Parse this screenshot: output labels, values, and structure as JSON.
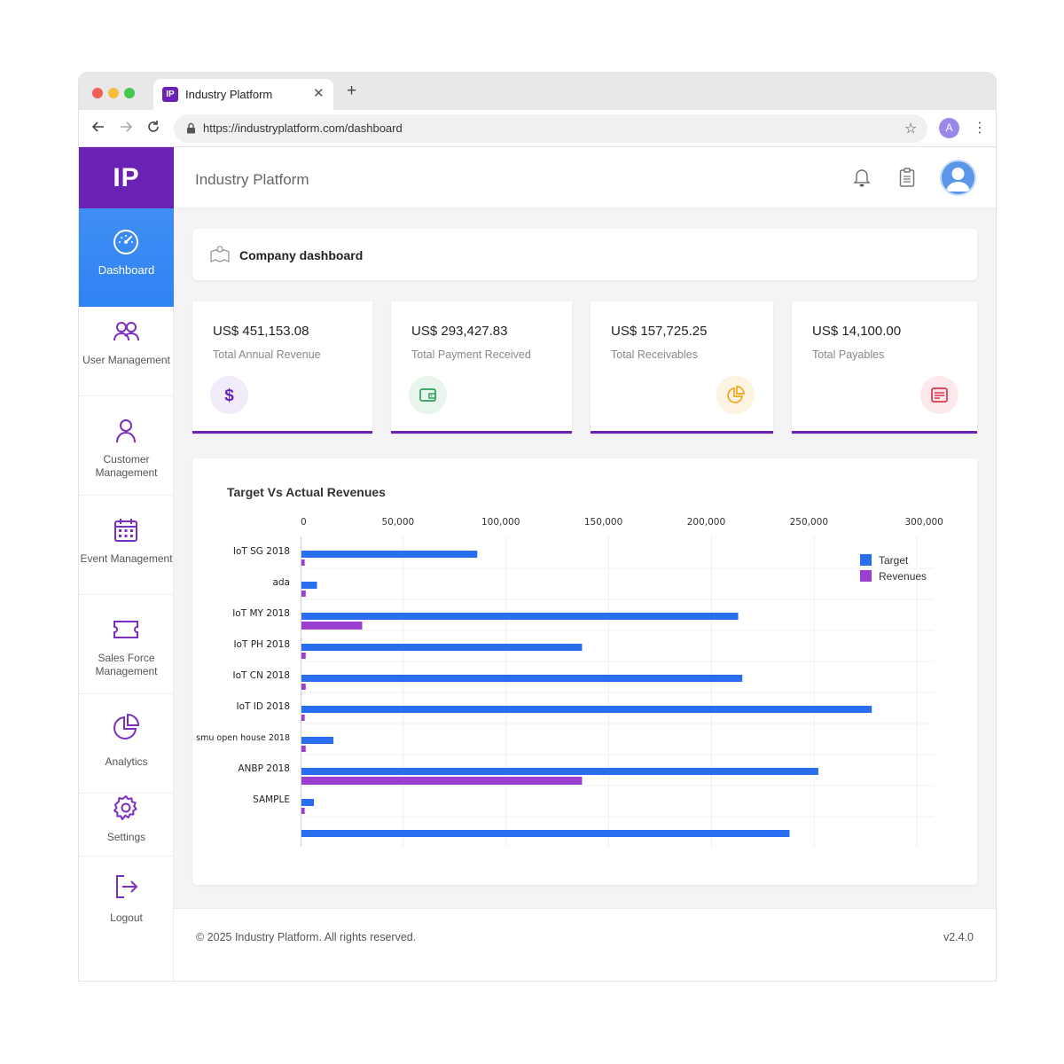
{
  "browser": {
    "tab_title": "Industry Platform",
    "tab_favicon": "IP",
    "url": "https://industryplatform.com/dashboard",
    "profile_initial": "A"
  },
  "sidebar": {
    "logo": "IP",
    "items": [
      {
        "label": "Dashboard",
        "icon": "speedometer-icon",
        "active": true
      },
      {
        "label": "User Management",
        "icon": "users-icon"
      },
      {
        "label": "Customer Management",
        "icon": "user-icon"
      },
      {
        "label": "Event Management",
        "icon": "calendar-icon"
      },
      {
        "label": "Sales Force Management",
        "icon": "ticket-icon"
      },
      {
        "label": "Analytics",
        "icon": "pie-chart-icon"
      },
      {
        "label": "Settings",
        "icon": "gear-icon"
      },
      {
        "label": "Logout",
        "icon": "logout-icon"
      }
    ]
  },
  "header": {
    "title": "Industry Platform"
  },
  "banner": {
    "title": "Company dashboard"
  },
  "cards": [
    {
      "value": "US$ 451,153.08",
      "label": "Total Annual Revenue",
      "icon": "dollar-icon",
      "color": "#6a22b4"
    },
    {
      "value": "US$  293,427.83",
      "label": "Total Payment Received",
      "icon": "wallet-icon",
      "color": "#2e9e5b"
    },
    {
      "value": "US$ 157,725.25",
      "label": "Total Receivables",
      "icon": "pie-chart-icon",
      "color": "#f0a81c"
    },
    {
      "value": "US$ 14,100.00",
      "label": "Total Payables",
      "icon": "invoice-icon",
      "color": "#e0334a"
    }
  ],
  "chart_data": {
    "type": "bar",
    "orientation": "horizontal",
    "title": "Target Vs Actual Revenues",
    "categories": [
      "IoT SG 2018",
      "ada",
      "IoT MY 2018",
      "IoT PH 2018",
      "IoT CN 2018",
      "IoT ID 2018",
      "smu open house 2018",
      "ANBP 2018",
      "SAMPLE",
      ""
    ],
    "series": [
      {
        "name": "Target",
        "color": "#2a6ef0",
        "values": [
          86000,
          8000,
          213000,
          137000,
          215000,
          278000,
          16000,
          252000,
          6500,
          238000
        ]
      },
      {
        "name": "Revenues",
        "color": "#9b3fd0",
        "values": [
          2000,
          2500,
          30000,
          2500,
          2500,
          2000,
          2500,
          137000,
          2000,
          0
        ]
      }
    ],
    "xlim": [
      0,
      300000
    ],
    "x_ticks": [
      "0",
      "50,000",
      "100,000",
      "150,000",
      "200,000",
      "250,000",
      "300,000"
    ],
    "x_axis_position": "top",
    "grid": true,
    "legend": "top-right"
  },
  "footer": {
    "copyright": "© 2025 Industry Platform. All rights reserved.",
    "version": "v2.4.0"
  }
}
